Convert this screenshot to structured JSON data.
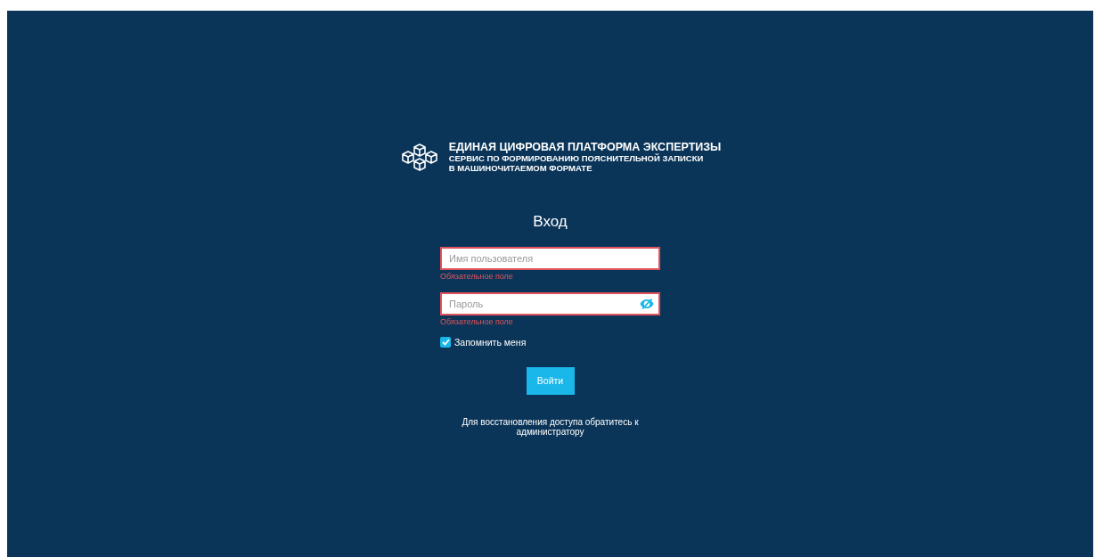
{
  "header": {
    "title": "ЕДИНАЯ ЦИФРОВАЯ ПЛАТФОРМА ЭКСПЕРТИЗЫ",
    "subtitle_lines": [
      "СЕРВИС ПО ФОРМИРОВАНИЮ ПОЯСНИТЕЛЬНОЙ ЗАПИСКИ",
      "В МАШИНОЧИТАЕМОМ ФОРМАТЕ"
    ]
  },
  "form": {
    "title": "Вход",
    "fields": [
      {
        "kind": "text",
        "placeholder": "Имя пользователя",
        "invalid": true,
        "error": "Обязательное поле"
      },
      {
        "kind": "password",
        "placeholder": "Пароль",
        "invalid": true,
        "error": "Обязательное поле"
      }
    ],
    "remember": {
      "label": "Запомнить меня",
      "checked": true
    },
    "submit": "Войти",
    "help": "Для восстановления доступа обратитесь к администратору"
  }
}
